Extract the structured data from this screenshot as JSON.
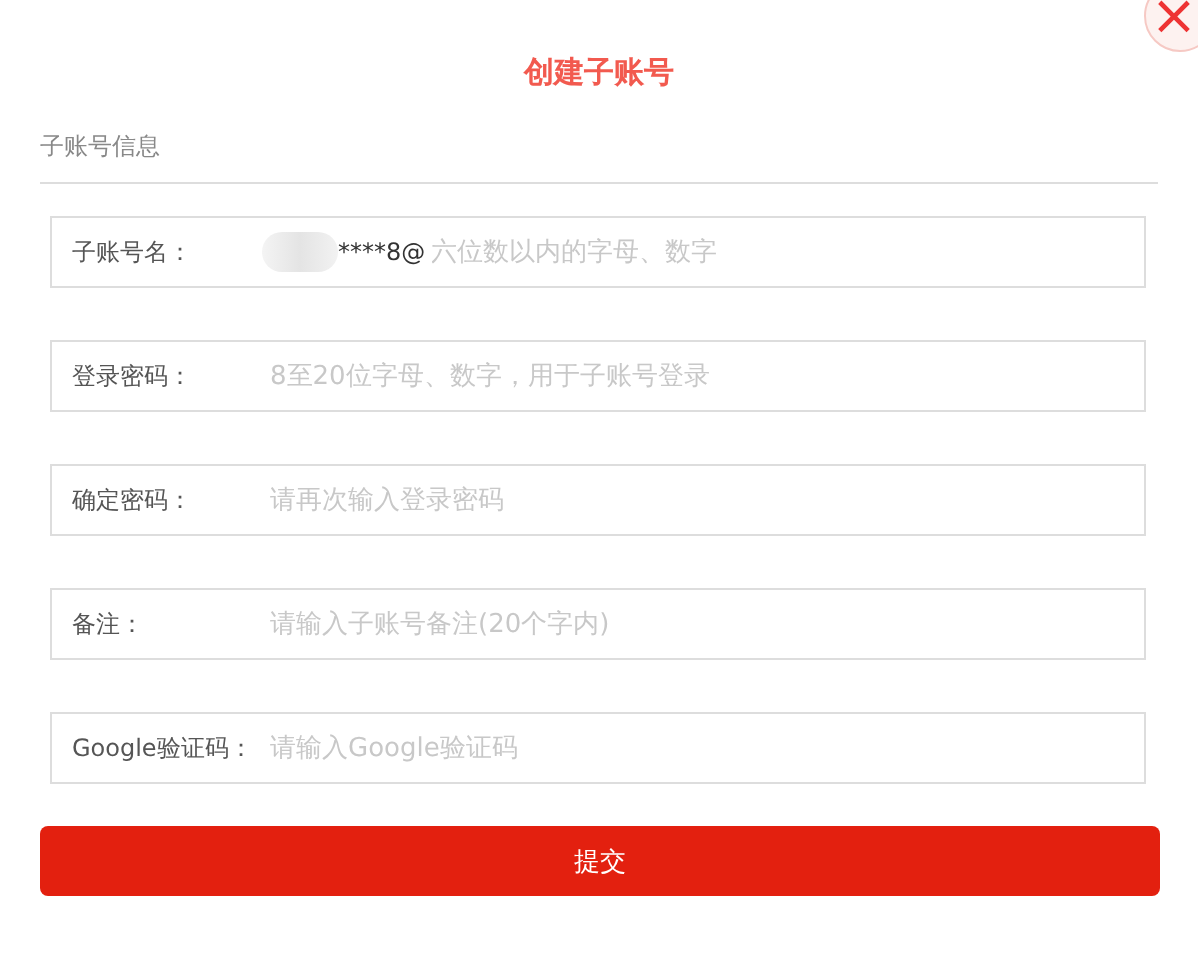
{
  "dialog": {
    "title": "创建子账号",
    "close": "×",
    "section": "子账号信息",
    "fields": [
      {
        "label": "子账号名：",
        "prefix": "****8@",
        "placeholder": "六位数以内的字母、数字"
      },
      {
        "label": "登录密码：",
        "placeholder": "8至20位字母、数字，用于子账号登录"
      },
      {
        "label": "确定密码：",
        "placeholder": "请再次输入登录密码"
      },
      {
        "label": "备注：",
        "placeholder": "请输入子账号备注(20个字内)"
      },
      {
        "label": "Google验证码：",
        "placeholder": "请输入Google验证码"
      }
    ],
    "submit": "提交"
  }
}
